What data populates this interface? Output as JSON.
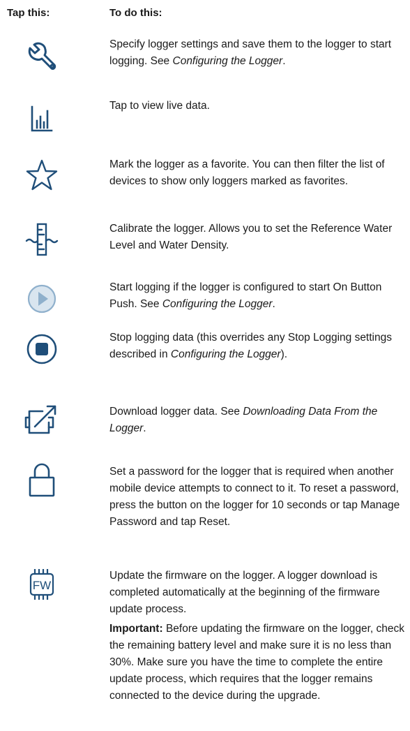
{
  "headers": {
    "tap": "Tap this:",
    "do": "To do this:"
  },
  "colors": {
    "icon_stroke": "#1f4e79",
    "play_fill": "#d9e5ef",
    "play_triangle": "#8fb0cc"
  },
  "rows": [
    {
      "icon": "wrench-icon",
      "parts": [
        "Specify logger settings and save them to the logger to start logging. See ",
        "Configuring the Logger",
        "."
      ]
    },
    {
      "icon": "bar-chart-icon",
      "parts": [
        "Tap to view live data."
      ]
    },
    {
      "icon": "star-icon",
      "parts": [
        "Mark the logger as a favorite. You can then filter the list of devices to show only loggers marked as favorites."
      ]
    },
    {
      "icon": "water-level-gauge-icon",
      "parts": [
        "Calibrate the logger. Allows you to set the Reference Water Level and Water Density."
      ]
    },
    {
      "icon": "play-icon",
      "parts": [
        "Start logging if the logger is configured to start On Button Push. See ",
        "Configuring the Logger",
        "."
      ]
    },
    {
      "icon": "stop-icon",
      "parts": [
        "Stop logging data (this overrides any Stop Logging settings described in ",
        "Configuring the Logger",
        ")."
      ]
    },
    {
      "icon": "download-icon",
      "parts": [
        "Download logger data. See ",
        "Downloading Data From the Logger",
        "."
      ]
    },
    {
      "icon": "lock-icon",
      "parts": [
        "Set a password for the logger that is required when another mobile device attempts to connect to it. To reset a password, press the button on the logger for 10 seconds or tap Manage Password and tap Reset."
      ]
    },
    {
      "icon": "firmware-icon",
      "icon_label": "FW",
      "parts": [
        "Update the firmware on the logger. A logger download is completed automatically at the beginning of the firmware update process."
      ]
    }
  ],
  "important": {
    "label": "Important:",
    "text": " Before updating the firmware on the logger, check the remaining battery level and make sure it is no less than 30%. Make sure you have the time to complete the entire update process, which requires that the logger remains connected to the device during the upgrade."
  }
}
